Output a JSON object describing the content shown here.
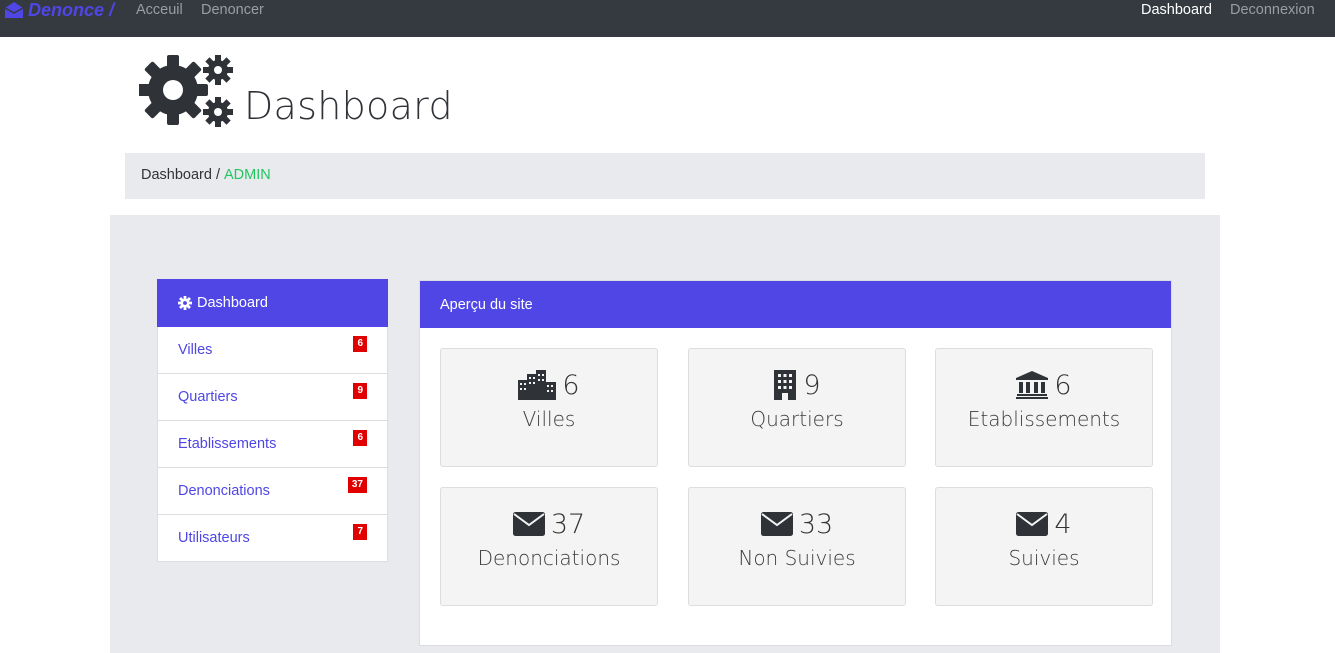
{
  "navbar": {
    "brand": "Denonce /",
    "links": [
      "Acceuil",
      "Denoncer"
    ],
    "right_links": [
      "Dashboard",
      "Deconnexion"
    ]
  },
  "header": {
    "title": "Dashboard",
    "icon": "cogs-icon"
  },
  "breadcrumb": {
    "root": "Dashboard",
    "separator": "/",
    "current": "ADMIN"
  },
  "sidebar": {
    "title": "Dashboard",
    "title_icon": "cog-icon",
    "items": [
      {
        "label": "Villes",
        "count": "6"
      },
      {
        "label": "Quartiers",
        "count": "9"
      },
      {
        "label": "Etablissements",
        "count": "6"
      },
      {
        "label": "Denonciations",
        "count": "37"
      },
      {
        "label": "Utilisateurs",
        "count": "7"
      }
    ]
  },
  "overview": {
    "title": "Aperçu du site",
    "stats": [
      {
        "icon": "city-icon",
        "value": "6",
        "label": "Villes"
      },
      {
        "icon": "building-icon",
        "value": "9",
        "label": "Quartiers"
      },
      {
        "icon": "university-icon",
        "value": "6",
        "label": "Etablissements"
      },
      {
        "icon": "envelope-icon",
        "value": "37",
        "label": "Denonciations"
      },
      {
        "icon": "envelope-icon",
        "value": "33",
        "label": "Non Suivies"
      },
      {
        "icon": "envelope-icon",
        "value": "4",
        "label": "Suivies"
      }
    ]
  },
  "colors": {
    "navbar_bg": "#343a40",
    "primary": "#4f46e5",
    "badge": "#e00000",
    "breadcrumb_active": "#22c55e",
    "panel_bg": "#e9eaee"
  }
}
